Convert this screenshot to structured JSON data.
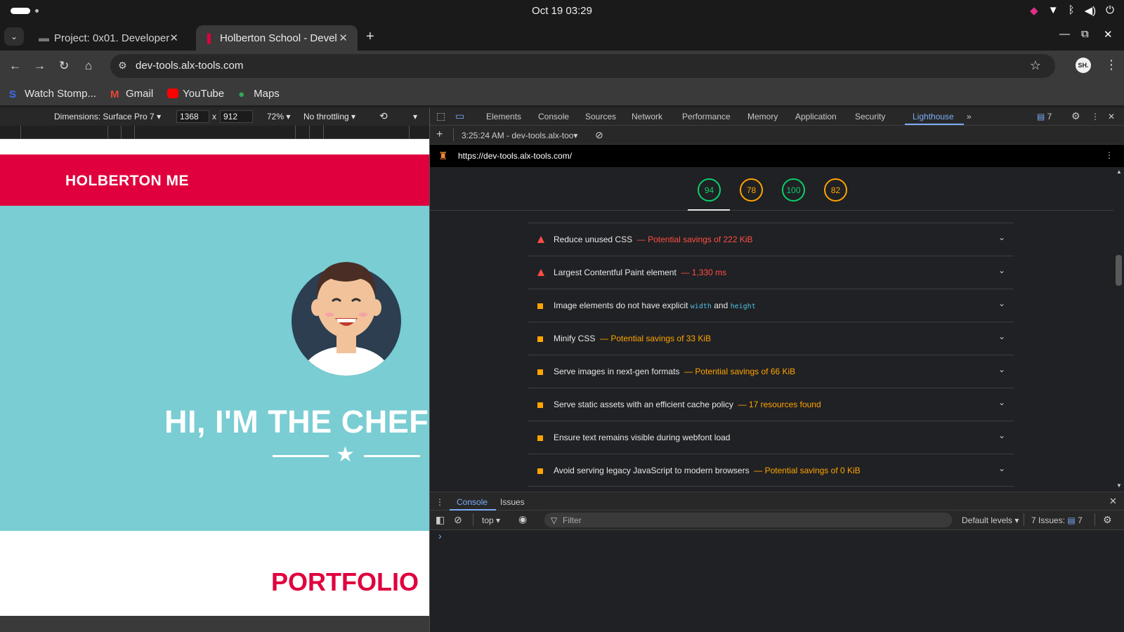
{
  "system": {
    "clock": "Oct 19  03:29",
    "tray_icons": [
      "app-icon",
      "wifi-icon",
      "bluetooth-icon",
      "volume-icon",
      "power-icon"
    ]
  },
  "tabs": [
    {
      "title": "Project: 0x01. Developer",
      "active": false
    },
    {
      "title": "Holberton School - Devel",
      "active": true
    }
  ],
  "toolbar": {
    "url": "dev-tools.alx-tools.com",
    "profile_initials": "SH."
  },
  "bookmarks": [
    {
      "label": "Watch Stomp...",
      "icon": "stomp-icon"
    },
    {
      "label": "Gmail",
      "icon": "gmail-icon"
    },
    {
      "label": "YouTube",
      "icon": "youtube-icon"
    },
    {
      "label": "Maps",
      "icon": "maps-icon"
    }
  ],
  "device_toolbar": {
    "dimensions_label": "Dimensions: Surface Pro 7",
    "width": "1368",
    "height": "912",
    "separator": "x",
    "zoom": "72%",
    "throttling": "No throttling"
  },
  "page": {
    "brand": "HOLBERTON ME",
    "hero_title": "HI, I'M THE CHEF",
    "portfolio": "PORTFOLIO"
  },
  "devtools": {
    "tabs": [
      "Elements",
      "Console",
      "Sources",
      "Network",
      "Performance",
      "Memory",
      "Application",
      "Security",
      "Lighthouse"
    ],
    "active_tab": "Lighthouse",
    "issues_count": "7",
    "report_selector": "3:25:24 AM - dev-tools.alx-too",
    "report_url": "https://dev-tools.alx-tools.com/"
  },
  "lighthouse": {
    "scores": [
      {
        "value": "94",
        "color": "#0cce6b"
      },
      {
        "value": "78",
        "color": "#ffa400"
      },
      {
        "value": "100",
        "color": "#0cce6b"
      },
      {
        "value": "82",
        "color": "#ffa400"
      }
    ],
    "audits": [
      {
        "severity": "fail",
        "title": "Reduce unused CSS",
        "detail": "— Potential savings of 222 KiB"
      },
      {
        "severity": "fail",
        "title": "Largest Contentful Paint element",
        "detail": "— 1,330 ms"
      },
      {
        "severity": "warn",
        "title_pre": "Image elements do not have explicit ",
        "code1": "width",
        "title_mid": " and ",
        "code2": "height"
      },
      {
        "severity": "warn",
        "title": "Minify CSS",
        "detail": "— Potential savings of 33 KiB"
      },
      {
        "severity": "warn",
        "title": "Serve images in next-gen formats",
        "detail": "— Potential savings of 66 KiB"
      },
      {
        "severity": "warn",
        "title": "Serve static assets with an efficient cache policy",
        "detail": "— 17 resources found"
      },
      {
        "severity": "warn",
        "title": "Ensure text remains visible during webfont load",
        "detail": ""
      },
      {
        "severity": "warn",
        "title": "Avoid serving legacy JavaScript to modern browsers",
        "detail": "— Potential savings of 0 KiB"
      }
    ]
  },
  "drawer": {
    "tabs": [
      "Console",
      "Issues"
    ],
    "context": "top",
    "filter_placeholder": "Filter",
    "levels": "Default levels",
    "issues_label": "7 Issues:",
    "issues_count": "7",
    "prompt": "›"
  }
}
